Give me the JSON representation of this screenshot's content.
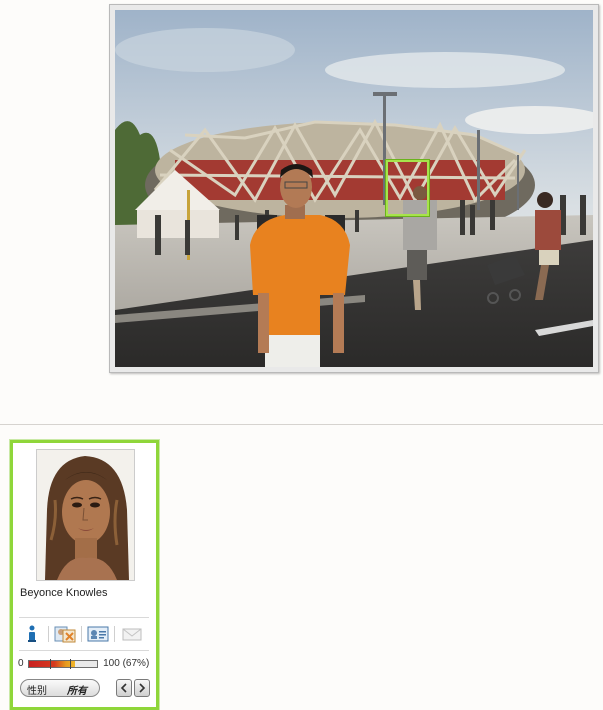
{
  "match": {
    "name": "Beyonce Knowles",
    "score_min": "0",
    "score_max": "100",
    "score_percent_text": "(67%)",
    "score_fraction": 0.67,
    "filter_label": "性别",
    "filter_value": "所有"
  },
  "icons": [
    "info-icon",
    "compare-faces-icon",
    "profile-card-icon",
    "email-icon",
    "prev-arrow-icon",
    "next-arrow-icon"
  ],
  "colors": {
    "face_box": "#a7e34c",
    "card_border": "#8fd63a"
  }
}
